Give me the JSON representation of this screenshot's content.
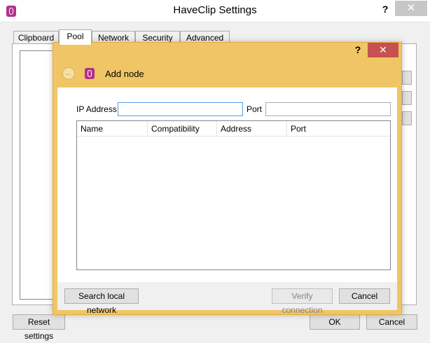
{
  "main_window": {
    "title": "HaveClip Settings",
    "help_label": "?",
    "close_label": "✕",
    "tabs": [
      {
        "label": "Clipboard",
        "active": false
      },
      {
        "label": "Pool",
        "active": true
      },
      {
        "label": "Network",
        "active": false
      },
      {
        "label": "Security",
        "active": false
      },
      {
        "label": "Advanced",
        "active": false
      }
    ],
    "reset_label": "Reset settings",
    "ok_label": "OK",
    "cancel_label": "Cancel"
  },
  "dialog": {
    "title": "Add node",
    "help_label": "?",
    "close_label": "✕",
    "back_icon_glyph": "←",
    "ip_label": "IP Address",
    "ip_value": "",
    "port_label": "Port",
    "port_value": "",
    "columns": [
      "Name",
      "Compatibility",
      "Address",
      "Port"
    ],
    "search_label": "Search local network",
    "verify_label": "Verify connection",
    "cancel_label": "Cancel"
  },
  "colors": {
    "dialog_frame": "#f0c565",
    "close_red": "#c75050",
    "app_icon": "#b3318c",
    "focus_border": "#569de5"
  }
}
